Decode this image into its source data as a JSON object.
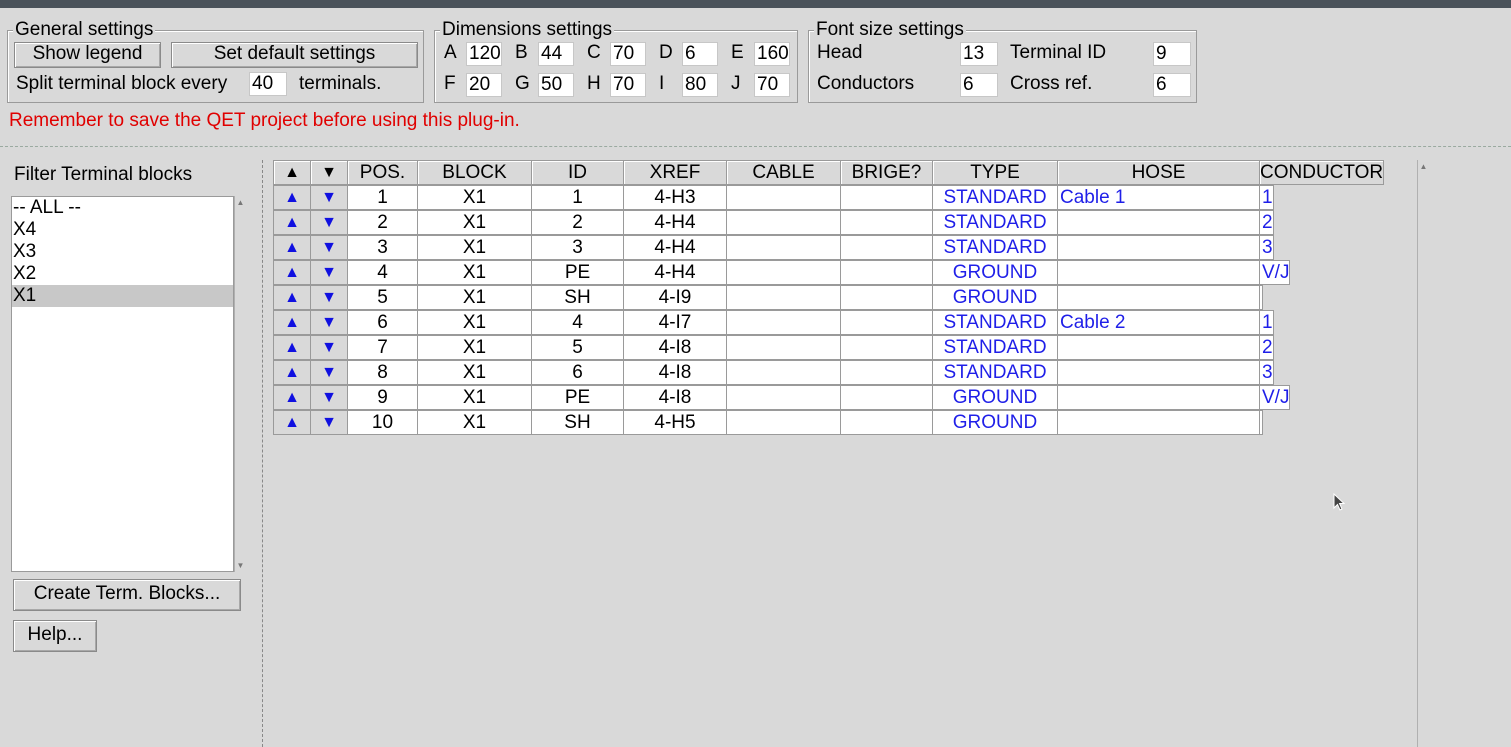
{
  "general": {
    "title": "General settings",
    "show_legend": "Show legend",
    "set_default": "Set default settings",
    "split_label": "Split terminal block every",
    "split_value": "40",
    "split_suffix": "terminals."
  },
  "dimensions": {
    "title": "Dimensions settings",
    "fields": [
      {
        "label": "A",
        "value": "120"
      },
      {
        "label": "B",
        "value": "44"
      },
      {
        "label": "C",
        "value": "70"
      },
      {
        "label": "D",
        "value": "6"
      },
      {
        "label": "E",
        "value": "160"
      },
      {
        "label": "F",
        "value": "20"
      },
      {
        "label": "G",
        "value": "50"
      },
      {
        "label": "H",
        "value": "70"
      },
      {
        "label": "I",
        "value": "80"
      },
      {
        "label": "J",
        "value": "70"
      }
    ]
  },
  "fontsize": {
    "title": "Font size settings",
    "head_label": "Head",
    "head_value": "13",
    "termid_label": "Terminal ID",
    "termid_value": "9",
    "conductors_label": "Conductors",
    "conductors_value": "6",
    "crossref_label": "Cross ref.",
    "crossref_value": "6"
  },
  "warning": "Remember to save the QET project before using this plug-in.",
  "filter": {
    "label": "Filter Terminal blocks",
    "items": [
      "-- ALL --",
      "X4",
      "X3",
      "X2",
      "X1"
    ],
    "selected": "X1"
  },
  "buttons": {
    "create": "Create Term. Blocks...",
    "help": "Help..."
  },
  "table": {
    "up_glyph": "▲",
    "down_glyph": "▼",
    "headers": [
      "POS.",
      "BLOCK",
      "ID",
      "XREF",
      "CABLE",
      "BRIGE?",
      "TYPE",
      "HOSE",
      "CONDUCTOR"
    ],
    "rows": [
      [
        "1",
        "X1",
        "1",
        "4-H3",
        "",
        "",
        "STANDARD",
        "Cable 1",
        "1"
      ],
      [
        "2",
        "X1",
        "2",
        "4-H4",
        "",
        "",
        "STANDARD",
        "",
        "2"
      ],
      [
        "3",
        "X1",
        "3",
        "4-H4",
        "",
        "",
        "STANDARD",
        "",
        "3"
      ],
      [
        "4",
        "X1",
        "PE",
        "4-H4",
        "",
        "",
        "GROUND",
        "",
        "V/J"
      ],
      [
        "5",
        "X1",
        "SH",
        "4-I9",
        "",
        "",
        "GROUND",
        "",
        ""
      ],
      [
        "6",
        "X1",
        "4",
        "4-I7",
        "",
        "",
        "STANDARD",
        "Cable 2",
        "1"
      ],
      [
        "7",
        "X1",
        "5",
        "4-I8",
        "",
        "",
        "STANDARD",
        "",
        "2"
      ],
      [
        "8",
        "X1",
        "6",
        "4-I8",
        "",
        "",
        "STANDARD",
        "",
        "3"
      ],
      [
        "9",
        "X1",
        "PE",
        "4-I8",
        "",
        "",
        "GROUND",
        "",
        "V/J"
      ],
      [
        "10",
        "X1",
        "SH",
        "4-H5",
        "",
        "",
        "GROUND",
        "",
        ""
      ]
    ]
  },
  "colors": {
    "warning": "#e00000",
    "editable_text": "#1f1fe8",
    "arrow": "#1010e0",
    "selection": "#c8c8c8"
  }
}
